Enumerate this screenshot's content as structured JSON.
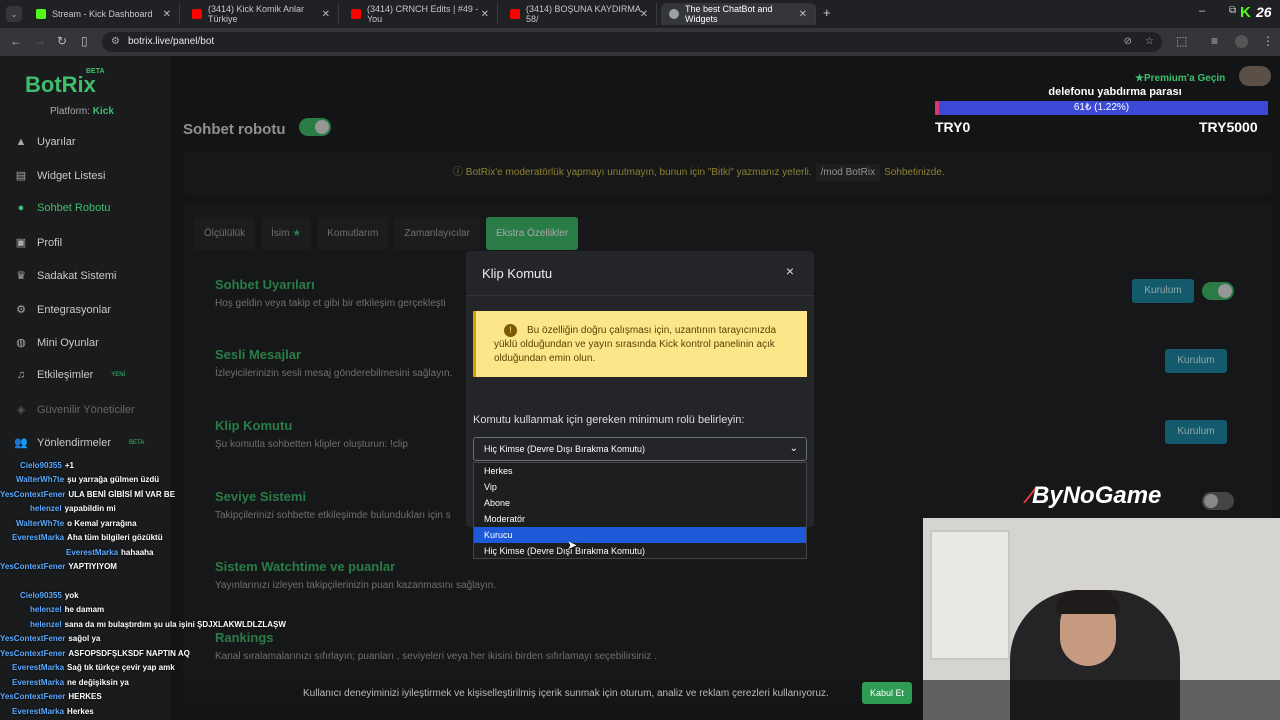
{
  "browser": {
    "tabs": [
      {
        "title": "Stream - Kick Dashboard",
        "color": "#53fc18"
      },
      {
        "title": "(3414) Kick Komik Anlar Türkiye",
        "color": "#ff0000"
      },
      {
        "title": "(3414) CRNCH Edits | #49 - You",
        "color": "#ff0000"
      },
      {
        "title": "(3414) BOŞUNA KAYDIRMA 58/",
        "color": "#ff0000"
      },
      {
        "title": "The best ChatBot and Widgets",
        "color": "#9aa0a6"
      }
    ],
    "url": "botrix.live/panel/bot",
    "kick_count": "26"
  },
  "sidebar": {
    "logo": "BotRix",
    "beta": "BETA",
    "platform_label": "Platform:",
    "platform_value": "Kick",
    "items": [
      {
        "label": "Uyarılar",
        "icon": "warning-icon"
      },
      {
        "label": "Widget Listesi",
        "icon": "widget-icon"
      },
      {
        "label": "Sohbet Robotu",
        "icon": "robot-icon"
      },
      {
        "label": "Profil",
        "icon": "profile-icon"
      },
      {
        "label": "Sadakat Sistemi",
        "icon": "trophy-icon"
      },
      {
        "label": "Entegrasyonlar",
        "icon": "integration-icon"
      },
      {
        "label": "Mini Oyunlar",
        "icon": "gamepad-icon"
      },
      {
        "label": "Etkileşimler",
        "icon": "music-icon"
      },
      {
        "label": "Güvenilir Yöneticiler",
        "icon": "shield-icon"
      },
      {
        "label": "Yönlendirmeler",
        "icon": "users-icon"
      }
    ],
    "new_badge": "YENİ",
    "beta_badge": "BETA"
  },
  "main": {
    "title": "Sohbet robotu",
    "notice_text": "BotRix'e moderatörlük yapmayı unutmayın, bunun için \"Bitki\" yazmanız yeterli.",
    "notice_code": "/mod BotRix",
    "notice_tail": "Sohbetinizde.",
    "tabs": [
      "Ölçülülük",
      "İsim",
      "Komutlarım",
      "Zamanlayıcılar",
      "Ekstra Özellikler"
    ],
    "sections": [
      {
        "title": "Sohbet Uyarıları",
        "desc": "Hoş geldin veya takip et gibi bir etkileşim gerçekleşti"
      },
      {
        "title": "Sesli Mesajlar",
        "desc": "İzleyicilerinizin sesli mesaj gönderebilmesini sağlayın."
      },
      {
        "title": "Klip Komutu",
        "desc": "Şu komutla sohbetten klipler oluşturun: !clip"
      },
      {
        "title": "Seviye Sistemi",
        "desc": "Takipçilerinizi sohbette etkileşimde bulundukları için s"
      },
      {
        "title": "Sistem Watchtime ve puanlar",
        "desc": "Yayınlarınızı izleyen takipçilerinizin puan kazanmasını sağlayın."
      },
      {
        "title": "Rankings",
        "desc": "Kanal sıralamalarınızı sıfırlayın; puanları , seviyeleri veya her ikisini birden sıfırlamayı seçebilirsiniz ."
      }
    ],
    "button_label": "Kurulum"
  },
  "modal": {
    "title": "Klip Komutu",
    "close": "×",
    "warning": "Bu özelliğin doğru çalışması için, uzantının tarayıcınızda yüklü olduğundan ve yayın sırasında Kick kontrol panelinin açık olduğundan emin olun.",
    "role_label": "Komutu kullanmak için gereken minimum rolü belirleyin:",
    "selected": "Hiç Kimse (Devre Dışı Bırakma Komutu)",
    "options": [
      "Herkes",
      "Vip",
      "Abone",
      "Moderatör",
      "Kurucu",
      "Hiç Kimse (Devre Dışı Bırakma Komutu)"
    ],
    "highlighted_option": "Kurucu"
  },
  "overlay": {
    "premium": "Premium'a Geçin",
    "goal_title": "delefonu yabdırma parası",
    "goal_text": "61₺ (1.22%)",
    "goal_progress": 0.0122,
    "goal_min": "TRY0",
    "goal_max": "TRY5000",
    "sponsor": "ByNoGame"
  },
  "chat": [
    {
      "user": "Cielo90355",
      "msg": "+1"
    },
    {
      "user": "WalterWh7te",
      "msg": "şu yarrağa gülmen üzdü"
    },
    {
      "user": "YesContextFener",
      "msg": "ULA BENİ GİBİSİ Mİ VAR BE"
    },
    {
      "user": "helenzel",
      "msg": "yapabildin mi"
    },
    {
      "user": "WalterWh7te",
      "msg": "o Kemal yarrağına"
    },
    {
      "user": "EverestMarka",
      "msg": "Aha tüm bilgileri gözüktü"
    },
    {
      "user": "EverestMarka",
      "msg": "hahaaha"
    },
    {
      "user": "YesContextFener",
      "msg": "YAPTIYIYOM"
    },
    {
      "user": "Cielo90355",
      "msg": "yok"
    },
    {
      "user": "helenzel",
      "msg": "he damam"
    },
    {
      "user": "helenzel",
      "msg": "sana da mı bulaştırdım şu ula işini ŞDJXLAKWLDLZLAŞW"
    },
    {
      "user": "YesContextFener",
      "msg": "sağol ya"
    },
    {
      "user": "YesContextFener",
      "msg": "ASFOPSDFŞLKSDF NAPTIN AQ"
    },
    {
      "user": "EverestMarka",
      "msg": "Sağ tık türkçe çevir yap amk"
    },
    {
      "user": "EverestMarka",
      "msg": "ne değişiksin ya"
    },
    {
      "user": "YesContextFener",
      "msg": "HERKES"
    },
    {
      "user": "EverestMarka",
      "msg": "Herkes"
    }
  ],
  "cookie": {
    "text": "Kullanıcı deneyiminizi iyileştirmek ve kişiselleştirilmiş içerik sunmak için oturum, analiz ve reklam çerezleri kullanıyoruz.",
    "accept": "Kabul Et"
  }
}
